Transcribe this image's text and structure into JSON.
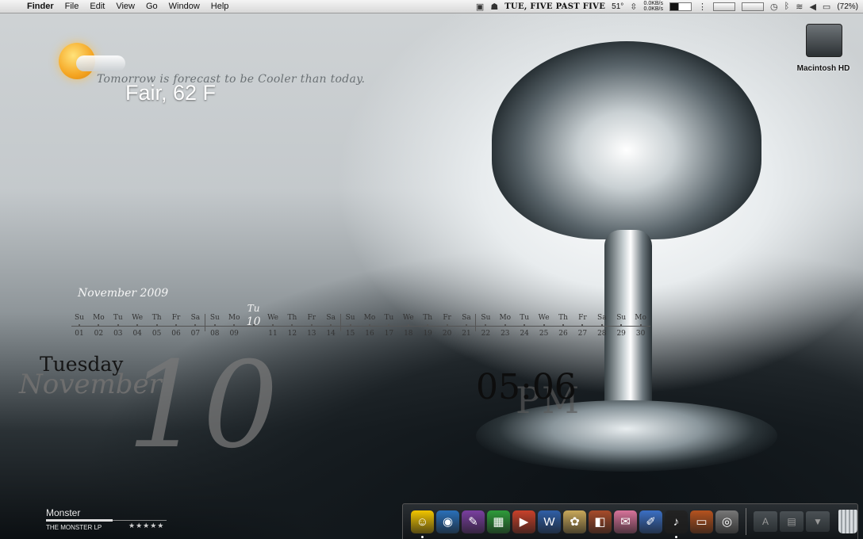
{
  "menubar": {
    "app_name": "Finder",
    "menus": [
      "File",
      "Edit",
      "View",
      "Go",
      "Window",
      "Help"
    ],
    "clock": "TUE, FIVE PAST FIVE",
    "temperature": "51°",
    "net_up": "0.0KB/s",
    "net_down": "0.0KB/s",
    "battery": "(72%)"
  },
  "weather": {
    "forecast": "Tomorrow is forecast to be Cooler than today.",
    "conditions": "Fair, 62 F"
  },
  "desktop": {
    "hd_label": "Macintosh HD"
  },
  "calendar": {
    "month_title": "November 2009",
    "days": [
      {
        "dow": "Su",
        "num": "01"
      },
      {
        "dow": "Mo",
        "num": "02"
      },
      {
        "dow": "Tu",
        "num": "03"
      },
      {
        "dow": "We",
        "num": "04"
      },
      {
        "dow": "Th",
        "num": "05"
      },
      {
        "dow": "Fr",
        "num": "06"
      },
      {
        "dow": "Sa",
        "num": "07"
      },
      {
        "dow": "Su",
        "num": "08"
      },
      {
        "dow": "Mo",
        "num": "09"
      },
      {
        "dow": "Tu",
        "num": "10"
      },
      {
        "dow": "We",
        "num": "11"
      },
      {
        "dow": "Th",
        "num": "12"
      },
      {
        "dow": "Fr",
        "num": "13"
      },
      {
        "dow": "Sa",
        "num": "14"
      },
      {
        "dow": "Su",
        "num": "15"
      },
      {
        "dow": "Mo",
        "num": "16"
      },
      {
        "dow": "Tu",
        "num": "17"
      },
      {
        "dow": "We",
        "num": "18"
      },
      {
        "dow": "Th",
        "num": "19"
      },
      {
        "dow": "Fr",
        "num": "20"
      },
      {
        "dow": "Sa",
        "num": "21"
      },
      {
        "dow": "Su",
        "num": "22"
      },
      {
        "dow": "Mo",
        "num": "23"
      },
      {
        "dow": "Tu",
        "num": "24"
      },
      {
        "dow": "We",
        "num": "25"
      },
      {
        "dow": "Th",
        "num": "26"
      },
      {
        "dow": "Fr",
        "num": "27"
      },
      {
        "dow": "Sa",
        "num": "28"
      },
      {
        "dow": "Su",
        "num": "29"
      },
      {
        "dow": "Mo",
        "num": "30"
      }
    ],
    "today_index": 9
  },
  "date_display": {
    "weekday": "Tuesday",
    "month": "November",
    "day": "10"
  },
  "clock_display": {
    "time": "05:06",
    "period": "PM"
  },
  "now_playing": {
    "track": "Monster",
    "album": "THE MONSTER LP",
    "rating_stars": "★★★★★",
    "progress": 0.55
  },
  "dock": {
    "apps": [
      {
        "name": "finder-icon",
        "glyph": "☺",
        "color": "#f2c500",
        "running": true
      },
      {
        "name": "network-globe-icon",
        "glyph": "◉",
        "color": "#2a6fb8",
        "running": false
      },
      {
        "name": "stationery-app-icon",
        "glyph": "✎",
        "color": "#7a3fa0",
        "running": false
      },
      {
        "name": "spreadsheet-app-icon",
        "glyph": "▦",
        "color": "#2e9b3a",
        "running": false
      },
      {
        "name": "presentation-app-icon",
        "glyph": "▶",
        "color": "#c8412b",
        "running": false
      },
      {
        "name": "document-app-icon",
        "glyph": "W",
        "color": "#2f5fa6",
        "running": false
      },
      {
        "name": "preview-app-icon",
        "glyph": "✿",
        "color": "#c9a85a",
        "running": false
      },
      {
        "name": "pdf-app-icon",
        "glyph": "◧",
        "color": "#a64b2a",
        "running": false
      },
      {
        "name": "photo-app-icon",
        "glyph": "✉",
        "color": "#d7739a",
        "running": false
      },
      {
        "name": "editor-app-icon",
        "glyph": "✐",
        "color": "#3b6fc4",
        "running": false
      },
      {
        "name": "media-player-icon",
        "glyph": "♪",
        "color": "#222222",
        "running": true
      },
      {
        "name": "briefcase-app-icon",
        "glyph": "▭",
        "color": "#b5531f",
        "running": false
      },
      {
        "name": "dvd-player-icon",
        "glyph": "◎",
        "color": "#777777",
        "running": false
      }
    ],
    "folders": [
      {
        "name": "applications-folder-icon",
        "glyph": "A"
      },
      {
        "name": "documents-folder-icon",
        "glyph": "▤"
      },
      {
        "name": "downloads-folder-icon",
        "glyph": "▼"
      }
    ]
  }
}
